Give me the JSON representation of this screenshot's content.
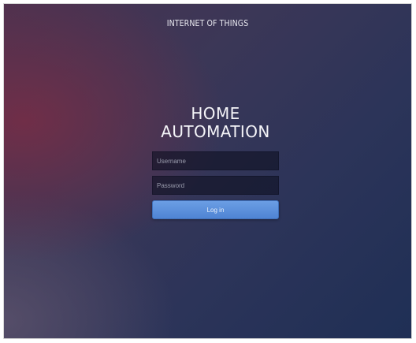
{
  "header": {
    "title": "INTERNET OF THINGS"
  },
  "login": {
    "heading_line1": "HOME",
    "heading_line2": "AUTOMATION",
    "username_placeholder": "Username",
    "username_value": "",
    "password_placeholder": "Password",
    "password_value": "",
    "button_label": "Log in"
  },
  "colors": {
    "button_accent": "#5a8fdb",
    "background_dark": "#1f2f55",
    "background_accent": "#782d46"
  }
}
